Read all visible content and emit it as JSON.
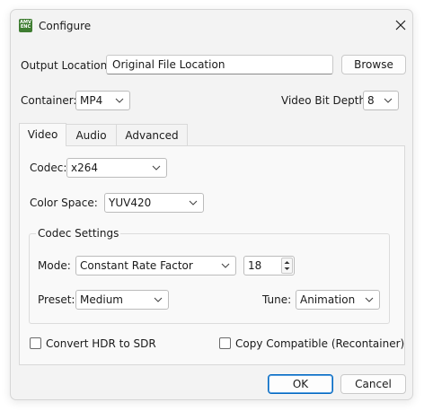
{
  "window": {
    "title": "Configure",
    "app_icon_text": [
      "AMV",
      "ENC"
    ]
  },
  "output": {
    "label": "Output Location:",
    "value": "Original File Location",
    "browse_label": "Browse"
  },
  "container": {
    "label": "Container:",
    "value": "MP4"
  },
  "bit_depth": {
    "label": "Video Bit Depth:",
    "value": "8"
  },
  "tabs": [
    {
      "label": "Video",
      "active": true
    },
    {
      "label": "Audio",
      "active": false
    },
    {
      "label": "Advanced",
      "active": false
    }
  ],
  "video": {
    "codec_label": "Codec:",
    "codec_value": "x264",
    "color_space_label": "Color Space:",
    "color_space_value": "YUV420",
    "codec_settings": {
      "title": "Codec Settings",
      "mode_label": "Mode:",
      "mode_value": "Constant Rate Factor",
      "crf_value": "18",
      "preset_label": "Preset:",
      "preset_value": "Medium",
      "tune_label": "Tune:",
      "tune_value": "Animation"
    },
    "hdr_label": "Convert HDR to SDR",
    "hdr_checked": false,
    "copy_label": "Copy Compatible (Recontainer)",
    "copy_checked": false
  },
  "footer": {
    "ok_label": "OK",
    "cancel_label": "Cancel"
  },
  "colors": {
    "accent": "#0067c0",
    "window_bg": "#f3f3f3",
    "icon_bg": "#3f7d32"
  }
}
